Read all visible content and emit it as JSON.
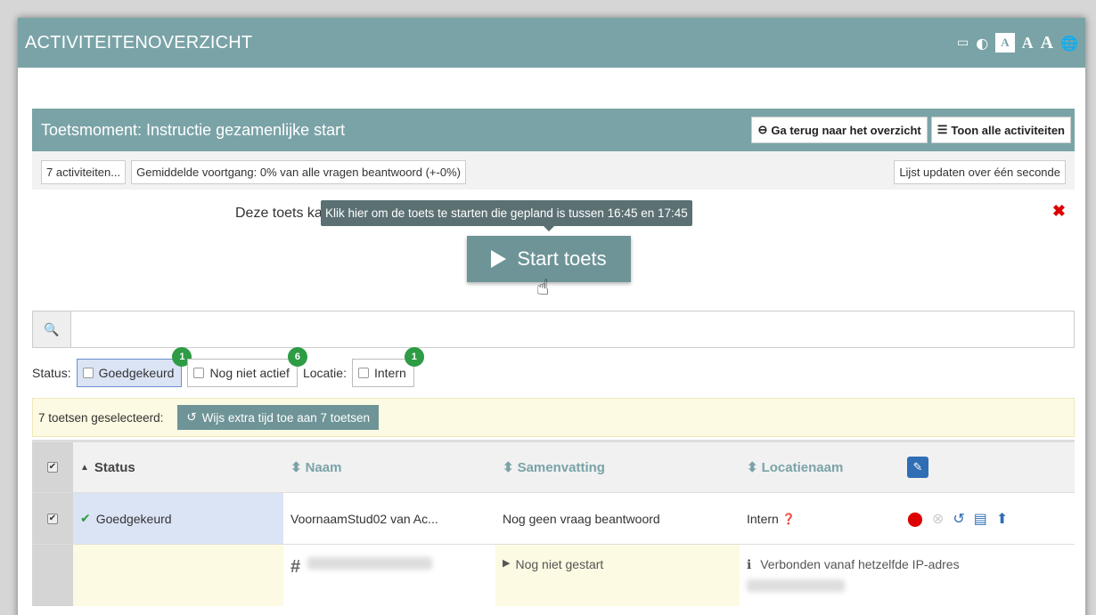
{
  "app": {
    "title": "ACTIVITEITENOVERZICHT"
  },
  "toolbar": {
    "icons": [
      "monitor-icon",
      "contrast-icon",
      "font-size-small",
      "font-size-medium",
      "font-size-large",
      "globe-icon"
    ],
    "monitor": "▭",
    "contrast": "◐",
    "a_small": "A",
    "a_med": "A",
    "a_large": "A",
    "globe": "🌐"
  },
  "panel": {
    "title": "Toetsmoment: Instructie gezamenlijke start",
    "back_label": "Ga terug naar het overzicht",
    "back_icon": "⊖",
    "all_label": "Toon alle activiteiten",
    "all_icon": "☰"
  },
  "stats": {
    "count": "7 activiteiten...",
    "progress": "Gemiddelde voortgang: 0% van alle vragen beantwoord (+-0%)",
    "update": "Lijst updaten over één seconde"
  },
  "notice": {
    "msg": "Deze toets kan gestart worden tussen 16:45 en 17:45",
    "tooltip": "Klik hier om de toets te starten die gepland is tussen 16:45 en 17:45",
    "start_label": "Start toets",
    "close": "✖",
    "cursor": "☝"
  },
  "search": {
    "icon": "🔍",
    "placeholder": ""
  },
  "filters": {
    "status_label": "Status:",
    "location_label": "Locatie:",
    "chips": [
      {
        "label": "Goedgekeurd",
        "count": "1"
      },
      {
        "label": "Nog niet actief",
        "count": "6"
      },
      {
        "label": "Intern",
        "count": "1"
      }
    ]
  },
  "selection": {
    "text": "7 toetsen geselecteerd:",
    "button": "Wijs extra tijd toe aan 7 toetsen",
    "button_icon": "↺"
  },
  "table": {
    "headers": {
      "status": "Status",
      "naam": "Naam",
      "samenvatting": "Samenvatting",
      "locatienaam": "Locatienaam"
    },
    "sort_asc": "▲",
    "sort_both": "⬍",
    "check": "✔",
    "edit": "✎",
    "rows": [
      {
        "status": "Goedgekeurd",
        "naam": "VoornaamStud02 van Ac...",
        "samenvatting": "Nog geen vraag beantwoord",
        "locatie": "Intern",
        "help": "❓"
      }
    ],
    "detail": {
      "hash": "#",
      "progress_icon": "▶",
      "progress": "Nog niet gestart",
      "info_icon": "ℹ",
      "info": "Verbonden vanaf hetzelfde IP-adres"
    },
    "actions": {
      "stop": "⬤",
      "cancel": "⊗",
      "history": "↺",
      "list": "▤",
      "upload": "⬆"
    }
  }
}
